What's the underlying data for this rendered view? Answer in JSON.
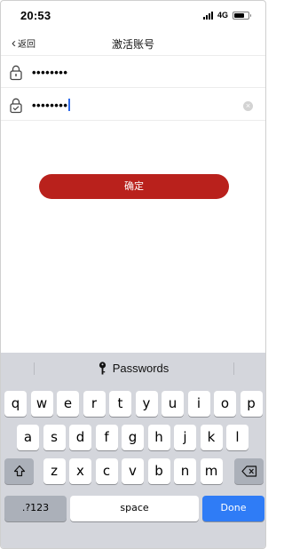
{
  "status_bar": {
    "time": "20:53",
    "network": "4G"
  },
  "nav": {
    "back_label": "返回",
    "title": "激活账号"
  },
  "form": {
    "password_1": "••••••••",
    "password_2": "••••••••"
  },
  "confirm_label": "确定",
  "keyboard": {
    "suggestion": "Passwords",
    "row1": [
      "q",
      "w",
      "e",
      "r",
      "t",
      "y",
      "u",
      "i",
      "o",
      "p"
    ],
    "row2": [
      "a",
      "s",
      "d",
      "f",
      "g",
      "h",
      "j",
      "k",
      "l"
    ],
    "row3": [
      "z",
      "x",
      "c",
      "v",
      "b",
      "n",
      "m"
    ],
    "numbers_label": ".?123",
    "space_label": "space",
    "done_label": "Done"
  },
  "colors": {
    "accent": "#b9211c",
    "done_key": "#2f7cf6",
    "cursor": "#2f6bea"
  }
}
